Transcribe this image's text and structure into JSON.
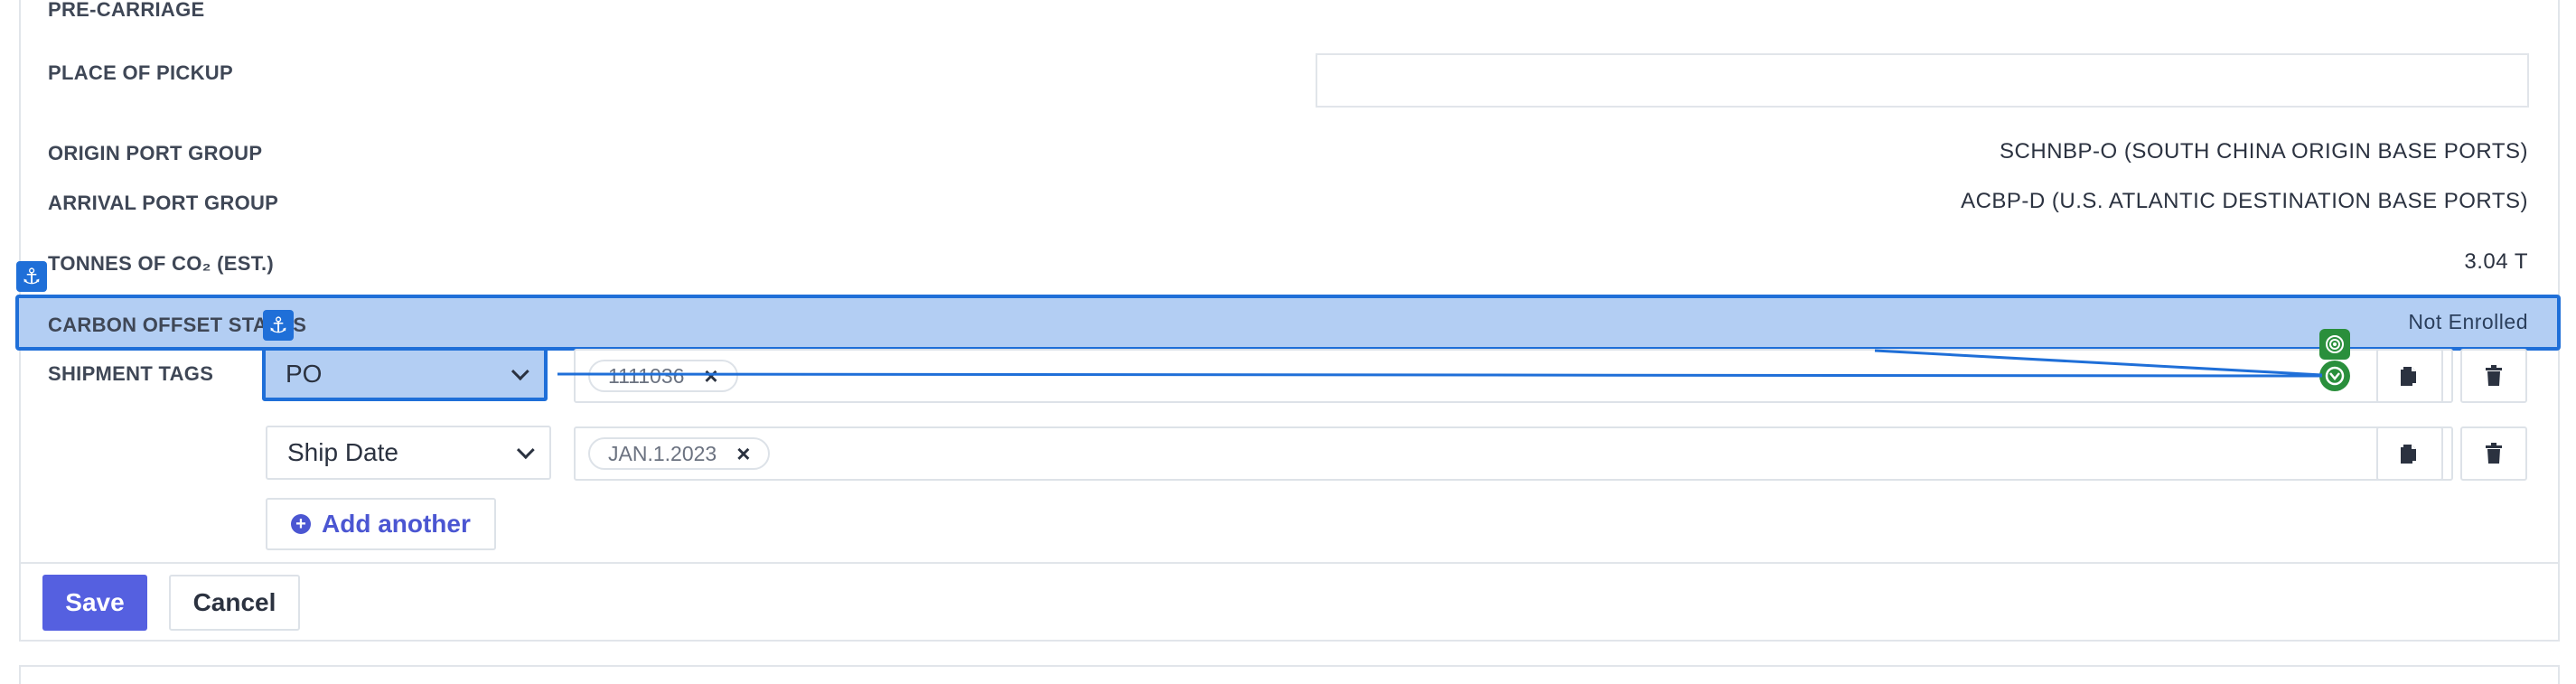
{
  "fields": {
    "pre_carriage_label": "PRE-CARRIAGE",
    "place_of_pickup_label": "PLACE OF PICKUP",
    "place_of_pickup_value": "",
    "origin_port_group_label": "ORIGIN PORT GROUP",
    "origin_port_group_value": "SCHNBP-O (SOUTH CHINA ORIGIN BASE PORTS)",
    "arrival_port_group_label": "ARRIVAL PORT GROUP",
    "arrival_port_group_value": "ACBP-D (U.S. ATLANTIC DESTINATION BASE PORTS)",
    "co2_label": "TONNES OF CO₂ (EST.)",
    "co2_value": "3.04 T",
    "carbon_offset_label": "CARBON OFFSET STATUS",
    "carbon_offset_value": "Not Enrolled"
  },
  "shipment_tags": {
    "label": "SHIPMENT TAGS",
    "rows": [
      {
        "type": "PO",
        "chip": "1111036",
        "chip_remove": "×",
        "clear": ""
      },
      {
        "type": "Ship Date",
        "chip": "JAN.1.2023",
        "chip_remove": "×",
        "clear": "×"
      }
    ],
    "add_another_label": "Add another",
    "add_icon": "+"
  },
  "actions": {
    "save_label": "Save",
    "cancel_label": "Cancel"
  },
  "icons": {
    "anchor": "⚓",
    "copy": "copy-icon",
    "trash": "trash-icon",
    "target": "target-icon"
  },
  "colors": {
    "highlight_fill": "#b3cef3",
    "highlight_border": "#1f6fd8",
    "primary_button": "#5560e0",
    "link": "#4b56d2",
    "badge_green": "#2a8f3c"
  }
}
